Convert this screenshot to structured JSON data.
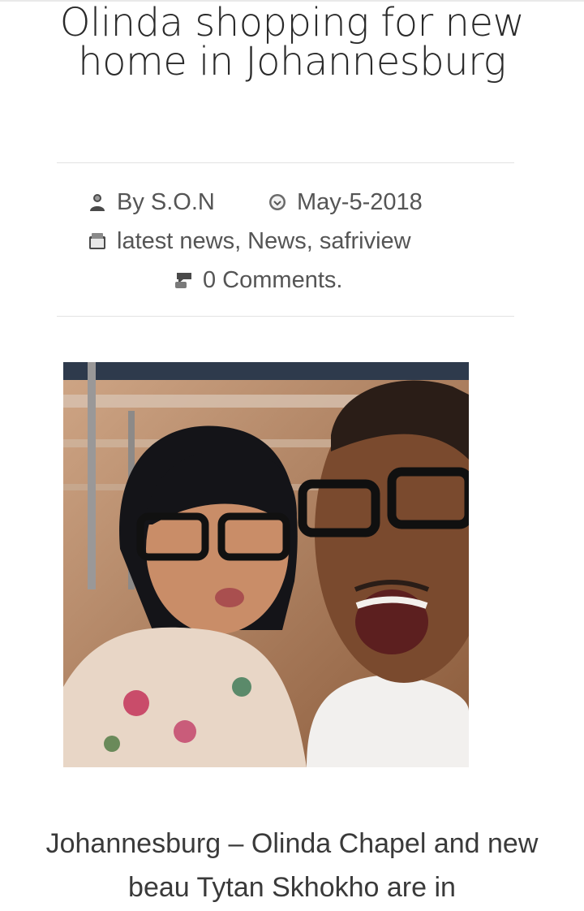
{
  "article": {
    "title": "Olinda shopping for new home in Johannesburg",
    "meta": {
      "author": "By S.O.N",
      "date": "May-5-2018",
      "categories": "latest news, News, safriview",
      "comments": "0 Comments."
    },
    "photo": {
      "description_icon": "article-photo"
    },
    "excerpt": "Johannesburg – Olinda Chapel and new beau Tytan Skhokho are in"
  },
  "icons": {
    "author": "user-icon",
    "date": "clock-icon",
    "category": "folder-icon",
    "comments": "comment-icon"
  },
  "colors": {
    "text": "#3a3a3a",
    "meta": "#555555",
    "rule": "#e2e2e2"
  }
}
